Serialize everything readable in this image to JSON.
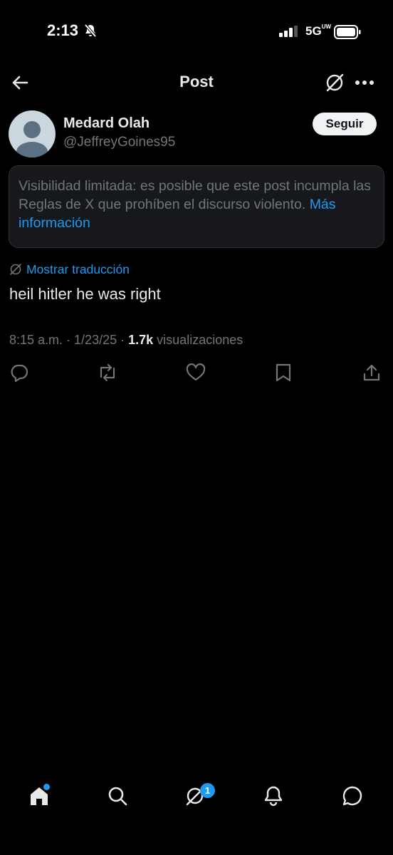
{
  "status_bar": {
    "time": "2:13",
    "network": "5G",
    "network_suffix": "UW"
  },
  "header": {
    "title": "Post"
  },
  "post": {
    "author_name": "Medard Olah",
    "author_handle": "@JeffreyGoines95",
    "follow_label": "Seguir",
    "notice_text": "Visibilidad limitada: es posible que este post incumpla las Reglas de X que prohíben el discurso violento.",
    "notice_link": "Más información",
    "translate_label": "Mostrar traducción",
    "text": "heil hitler he was right",
    "time": "8:15 a.m.",
    "date": "1/23/25",
    "views_count": "1.7k",
    "views_label": "visualizaciones"
  },
  "actions": {
    "icons": [
      "reply-icon",
      "repost-icon",
      "like-icon",
      "bookmark-icon",
      "share-icon"
    ]
  },
  "bottom_nav": {
    "items": [
      "home-icon",
      "search-icon",
      "grok-icon",
      "notifications-icon",
      "messages-icon"
    ],
    "grok_badge": "1"
  },
  "colors": {
    "background": "#000000",
    "text": "#e7e9ea",
    "secondary": "#71767b",
    "accent": "#1d9bf0"
  }
}
